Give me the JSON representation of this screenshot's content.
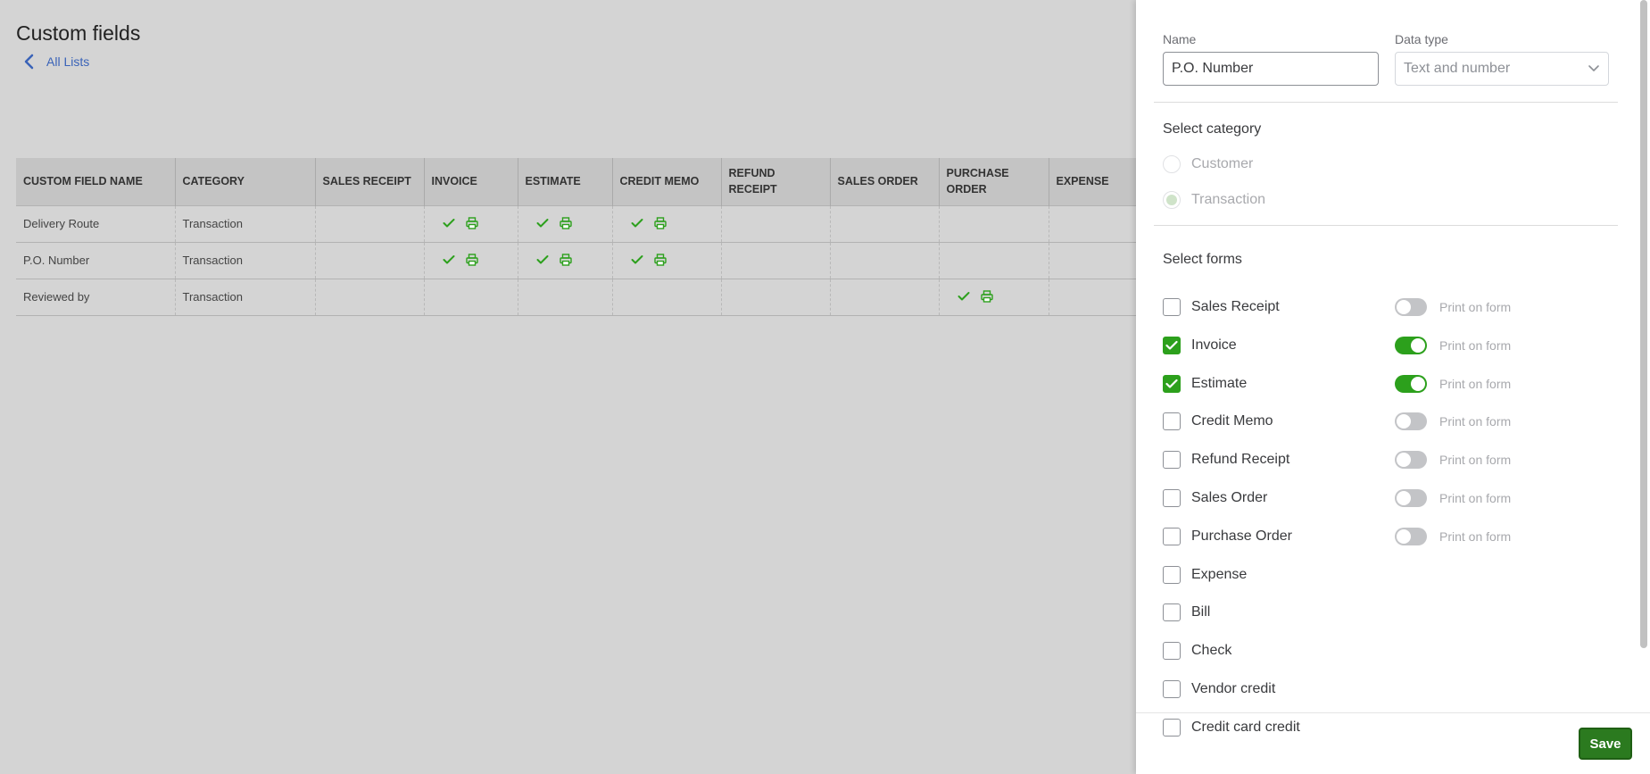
{
  "page": {
    "title": "Custom fields",
    "back_link": "All Lists"
  },
  "table": {
    "columns": [
      "CUSTOM FIELD NAME",
      "CATEGORY",
      "SALES RECEIPT",
      "INVOICE",
      "ESTIMATE",
      "CREDIT MEMO",
      "REFUND RECEIPT",
      "SALES ORDER",
      "PURCHASE ORDER",
      "EXPENSE"
    ],
    "rows": [
      {
        "name": "Delivery Route",
        "category": "Transaction",
        "forms": [
          "Invoice",
          "Estimate",
          "Credit Memo"
        ]
      },
      {
        "name": "P.O. Number",
        "category": "Transaction",
        "forms": [
          "Invoice",
          "Estimate",
          "Credit Memo"
        ]
      },
      {
        "name": "Reviewed by",
        "category": "Transaction",
        "forms": [
          "Purchase Order"
        ]
      }
    ]
  },
  "panel": {
    "name_label": "Name",
    "name_value": "P.O. Number",
    "data_type_label": "Data type",
    "data_type_value": "Text and number",
    "category_title": "Select category",
    "categories": [
      {
        "label": "Customer",
        "selected": false
      },
      {
        "label": "Transaction",
        "selected": true
      }
    ],
    "forms_title": "Select forms",
    "print_label": "Print on form",
    "forms": [
      {
        "label": "Sales Receipt",
        "checked": false,
        "has_print": true,
        "print_on": false
      },
      {
        "label": "Invoice",
        "checked": true,
        "has_print": true,
        "print_on": true
      },
      {
        "label": "Estimate",
        "checked": true,
        "has_print": true,
        "print_on": true
      },
      {
        "label": "Credit Memo",
        "checked": false,
        "has_print": true,
        "print_on": false
      },
      {
        "label": "Refund Receipt",
        "checked": false,
        "has_print": true,
        "print_on": false
      },
      {
        "label": "Sales Order",
        "checked": false,
        "has_print": true,
        "print_on": false
      },
      {
        "label": "Purchase Order",
        "checked": false,
        "has_print": true,
        "print_on": false
      },
      {
        "label": "Expense",
        "checked": false,
        "has_print": false,
        "print_on": false
      },
      {
        "label": "Bill",
        "checked": false,
        "has_print": false,
        "print_on": false
      },
      {
        "label": "Check",
        "checked": false,
        "has_print": false,
        "print_on": false
      },
      {
        "label": "Vendor credit",
        "checked": false,
        "has_print": false,
        "print_on": false
      },
      {
        "label": "Credit card credit",
        "checked": false,
        "has_print": false,
        "print_on": false
      }
    ],
    "save_label": "Save"
  },
  "colors": {
    "accent_green": "#2ca01c",
    "link_blue": "#3a63b8",
    "save_green": "#2b7a1f"
  },
  "icons": {
    "check": "check-icon",
    "print": "print-icon",
    "back": "chevron-left-icon",
    "dropdown": "chevron-down-icon"
  }
}
